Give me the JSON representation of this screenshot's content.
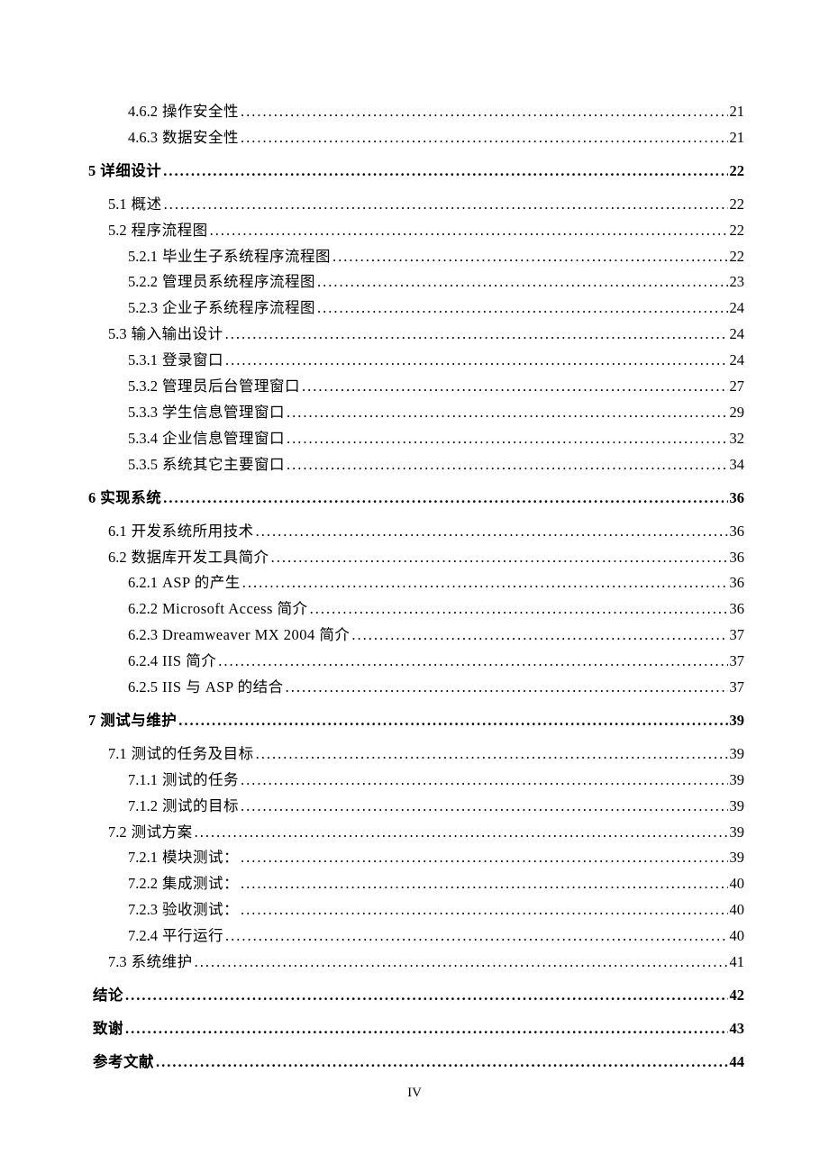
{
  "page_number": "IV",
  "toc": [
    {
      "level": 2,
      "num": "4.6.2",
      "title": "操作安全性",
      "page": "21"
    },
    {
      "level": 2,
      "num": "4.6.3",
      "title": "数据安全性",
      "page": "21"
    },
    {
      "gap": true
    },
    {
      "level": 0,
      "num": "5",
      "title": "详细设计",
      "page": "22"
    },
    {
      "gap": true
    },
    {
      "level": 1,
      "num": "5.1",
      "title": "概述",
      "page": "22"
    },
    {
      "level": 1,
      "num": "5.2",
      "title": "程序流程图",
      "page": "22"
    },
    {
      "level": 2,
      "num": "5.2.1",
      "title": "毕业生子系统程序流程图",
      "page": "22"
    },
    {
      "level": 2,
      "num": "5.2.2",
      "title": "管理员系统程序流程图",
      "page": "23"
    },
    {
      "level": 2,
      "num": "5.2.3",
      "title": "企业子系统程序流程图",
      "page": "24"
    },
    {
      "level": 1,
      "num": "5.3",
      "title": "输入输出设计",
      "page": "24"
    },
    {
      "level": 2,
      "num": "5.3.1",
      "title": "登录窗口",
      "page": "24"
    },
    {
      "level": 2,
      "num": "5.3.2",
      "title": "管理员后台管理窗口",
      "page": "27"
    },
    {
      "level": 2,
      "num": "5.3.3",
      "title": "学生信息管理窗口",
      "page": "29"
    },
    {
      "level": 2,
      "num": "5.3.4",
      "title": "企业信息管理窗口",
      "page": "32"
    },
    {
      "level": 2,
      "num": "5.3.5",
      "title": "系统其它主要窗口",
      "page": "34"
    },
    {
      "gap": true
    },
    {
      "level": 0,
      "num": "6",
      "title": "实现系统",
      "page": "36"
    },
    {
      "gap": true
    },
    {
      "level": 1,
      "num": "6.1",
      "title": "开发系统所用技术",
      "page": "36"
    },
    {
      "level": 1,
      "num": "6.2",
      "title": "数据库开发工具简介",
      "page": "36"
    },
    {
      "level": 2,
      "num": "6.2.1",
      "title": "ASP 的产生",
      "page": "36"
    },
    {
      "level": 2,
      "num": "6.2.2",
      "title": "Microsoft Access 简介",
      "page": "36"
    },
    {
      "level": 2,
      "num": "6.2.3",
      "title": "Dreamweaver  MX  2004 简介",
      "page": "37"
    },
    {
      "level": 2,
      "num": "6.2.4",
      "title": "IIS 简介",
      "page": "37"
    },
    {
      "level": 2,
      "num": "6.2.5",
      "title": "IIS 与 ASP 的结合",
      "page": "37"
    },
    {
      "gap": true
    },
    {
      "level": 0,
      "num": "7",
      "title": "测试与维护",
      "page": "39"
    },
    {
      "gap": true
    },
    {
      "level": 1,
      "num": "7.1",
      "title": "测试的任务及目标",
      "page": "39"
    },
    {
      "level": 2,
      "num": "7.1.1",
      "title": "测试的任务",
      "page": "39"
    },
    {
      "level": 2,
      "num": "7.1.2",
      "title": "测试的目标",
      "page": "39"
    },
    {
      "level": 1,
      "num": "7.2",
      "title": "测试方案",
      "page": "39",
      "italic": true
    },
    {
      "level": 2,
      "num": "7.2.1",
      "title": "模块测试：",
      "page": "39"
    },
    {
      "level": 2,
      "num": "7.2.2",
      "title": "集成测试：",
      "page": "40"
    },
    {
      "level": 2,
      "num": "7.2.3",
      "title": "验收测试：",
      "page": "40"
    },
    {
      "level": 2,
      "num": "7.2.4",
      "title": "平行运行",
      "page": "40"
    },
    {
      "level": 1,
      "num": "7.3",
      "title": "系统维护",
      "page": "41",
      "italic": true
    },
    {
      "gap": true
    },
    {
      "level": 0,
      "num": "",
      "title": "结论",
      "page": "42"
    },
    {
      "gap": true
    },
    {
      "level": 0,
      "num": "",
      "title": "致谢",
      "page": "43"
    },
    {
      "gap": true
    },
    {
      "level": 0,
      "num": "",
      "title": "参考文献",
      "page": "44"
    }
  ]
}
